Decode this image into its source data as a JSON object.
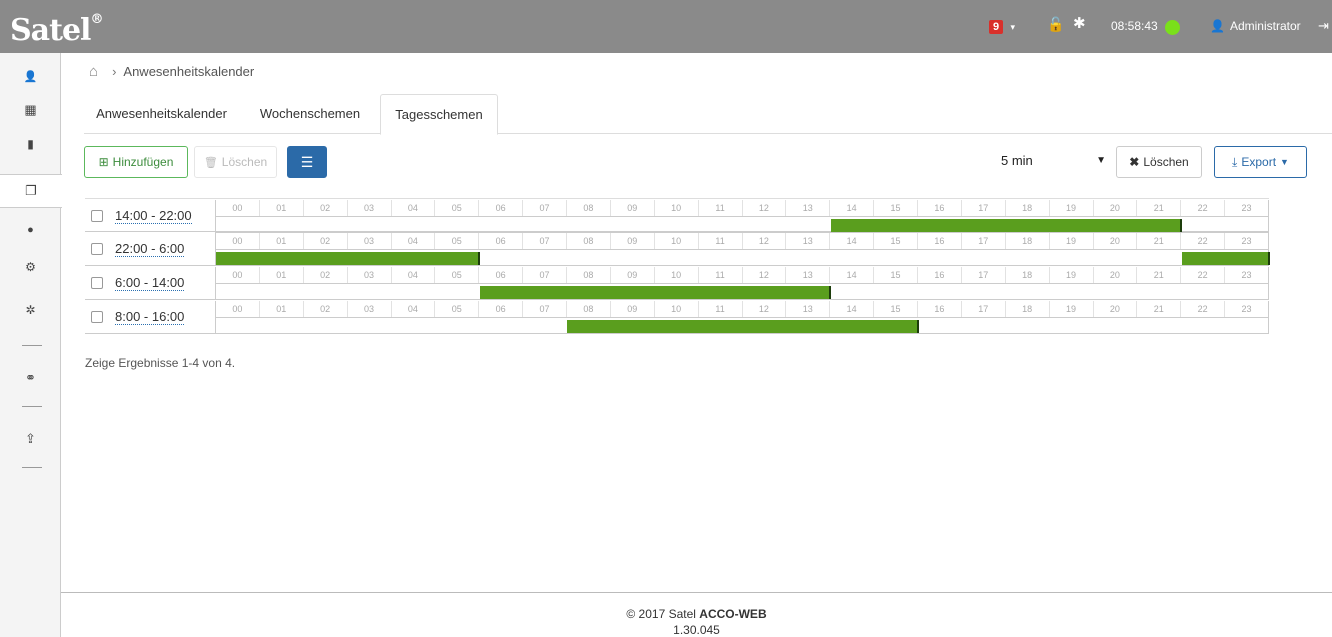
{
  "topbar": {
    "logo": "Satel",
    "logo_mark": "®",
    "alerts_count": "9",
    "time": "08:58:43",
    "user": "Administrator",
    "status_color": "#7ae01a"
  },
  "sidebar": {
    "items": [
      {
        "icon": "user-icon",
        "glyph": "👤"
      },
      {
        "icon": "calendar-icon",
        "glyph": "▦"
      },
      {
        "icon": "document-icon",
        "glyph": "▮"
      },
      {
        "icon": "copy-icon",
        "glyph": "❐"
      },
      {
        "icon": "globe-icon",
        "glyph": "●"
      },
      {
        "icon": "cogs-icon",
        "glyph": "⚙"
      },
      {
        "icon": "gear-icon",
        "glyph": "✲"
      },
      {
        "icon": "network-icon",
        "glyph": "⚭"
      },
      {
        "icon": "upload-icon",
        "glyph": "⇪"
      }
    ]
  },
  "breadcrumb": {
    "current": "Anwesenheitskalender"
  },
  "tabs": [
    {
      "label": "Anwesenheitskalender",
      "active": false
    },
    {
      "label": "Wochenschemen",
      "active": false
    },
    {
      "label": "Tagesschemen",
      "active": true
    }
  ],
  "toolbar": {
    "add_label": "Hinzufügen",
    "delete_label": "Löschen",
    "interval": "5 min",
    "clear_label": "Löschen",
    "export_label": "Export"
  },
  "hours": [
    "00",
    "01",
    "02",
    "03",
    "04",
    "05",
    "06",
    "07",
    "08",
    "09",
    "10",
    "11",
    "12",
    "13",
    "14",
    "15",
    "16",
    "17",
    "18",
    "19",
    "20",
    "21",
    "22",
    "23"
  ],
  "schedules": [
    {
      "name": "14:00 - 22:00",
      "segments": [
        [
          14,
          22
        ]
      ]
    },
    {
      "name": "22:00 - 6:00",
      "segments": [
        [
          0,
          6
        ],
        [
          22,
          24
        ]
      ]
    },
    {
      "name": "6:00 - 14:00",
      "segments": [
        [
          6,
          14
        ]
      ]
    },
    {
      "name": "8:00 - 16:00",
      "segments": [
        [
          8,
          16
        ]
      ]
    }
  ],
  "results_text": "Zeige Ergebnisse 1-4 von 4.",
  "footer": {
    "copyright": "© 2017 Satel",
    "product": "ACCO-WEB",
    "version": "1.30.045"
  },
  "colors": {
    "active_bar": "#5a9e1e",
    "primary": "#2b6aa8",
    "success": "#5cb85c"
  }
}
